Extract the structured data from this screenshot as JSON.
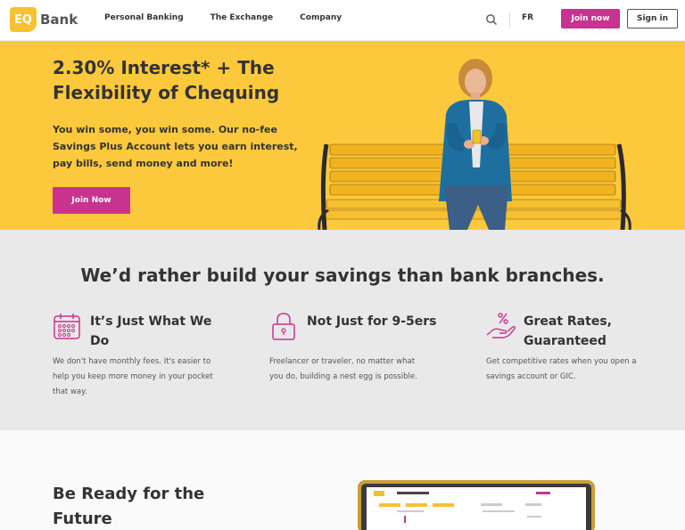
{
  "header": {
    "logo_mark": "EQ",
    "logo_text": "Bank",
    "nav": [
      "Personal Banking",
      "The Exchange",
      "Company"
    ],
    "lang": "FR",
    "join_label": "Join now",
    "signin_label": "Sign in"
  },
  "hero": {
    "title": "2.30% Interest* + The Flexibility of Chequing",
    "subtitle": "You win some, you win some. Our no-fee Savings Plus Account lets you earn interest, pay bills, send money and more!",
    "cta": "Join Now"
  },
  "features": {
    "title": "We’d rather build your savings than bank branches.",
    "items": [
      {
        "icon": "calendar-icon",
        "title": "It’s Just What We Do",
        "desc": "We don't have monthly fees. It's easier to help you keep more money in your pocket that way."
      },
      {
        "icon": "lock-icon",
        "title": "Not Just for 9-5ers",
        "desc": "Freelancer or traveler, no matter what you do, building a nest egg is possible."
      },
      {
        "icon": "percent-hand-icon",
        "title": "Great Rates, Guaranteed",
        "desc": "Get competitive rates when you open a savings account or GIC."
      }
    ]
  },
  "future": {
    "title": "Be Ready for the Future"
  },
  "colors": {
    "brand_yellow": "#fdc93c",
    "brand_magenta": "#c8338f"
  }
}
